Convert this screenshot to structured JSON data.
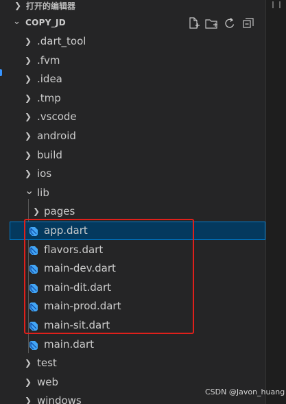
{
  "explorer": {
    "open_editors_label": "打开的编辑器",
    "project_name": "COPY_JD",
    "header_icons": [
      "new-file-icon",
      "new-folder-icon",
      "refresh-icon",
      "collapse-all-icon"
    ]
  },
  "tree": [
    {
      "label": ".dart_tool",
      "kind": "folder",
      "expanded": false,
      "depth": 0
    },
    {
      "label": ".fvm",
      "kind": "folder",
      "expanded": false,
      "depth": 0
    },
    {
      "label": ".idea",
      "kind": "folder",
      "expanded": false,
      "depth": 0
    },
    {
      "label": ".tmp",
      "kind": "folder",
      "expanded": false,
      "depth": 0
    },
    {
      "label": ".vscode",
      "kind": "folder",
      "expanded": false,
      "depth": 0
    },
    {
      "label": "android",
      "kind": "folder",
      "expanded": false,
      "depth": 0
    },
    {
      "label": "build",
      "kind": "folder",
      "expanded": false,
      "depth": 0
    },
    {
      "label": "ios",
      "kind": "folder",
      "expanded": false,
      "depth": 0
    },
    {
      "label": "lib",
      "kind": "folder",
      "expanded": true,
      "depth": 0
    },
    {
      "label": "pages",
      "kind": "folder",
      "expanded": false,
      "depth": 1
    },
    {
      "label": "app.dart",
      "kind": "dart",
      "depth": 1,
      "selected": true
    },
    {
      "label": "flavors.dart",
      "kind": "dart",
      "depth": 1
    },
    {
      "label": "main-dev.dart",
      "kind": "dart",
      "depth": 1
    },
    {
      "label": "main-dit.dart",
      "kind": "dart",
      "depth": 1
    },
    {
      "label": "main-prod.dart",
      "kind": "dart",
      "depth": 1
    },
    {
      "label": "main-sit.dart",
      "kind": "dart",
      "depth": 1
    },
    {
      "label": "main.dart",
      "kind": "dart",
      "depth": 1
    },
    {
      "label": "test",
      "kind": "folder",
      "expanded": false,
      "depth": 0
    },
    {
      "label": "web",
      "kind": "folder",
      "expanded": false,
      "depth": 0
    },
    {
      "label": "windows",
      "kind": "folder",
      "expanded": false,
      "depth": 0
    }
  ],
  "colors": {
    "selection_bg": "#04395e",
    "selection_border": "#007fd4",
    "annotation": "#e0201b",
    "dart_icon": "#42a5f5"
  },
  "watermark": "CSDN @Javon_huang"
}
